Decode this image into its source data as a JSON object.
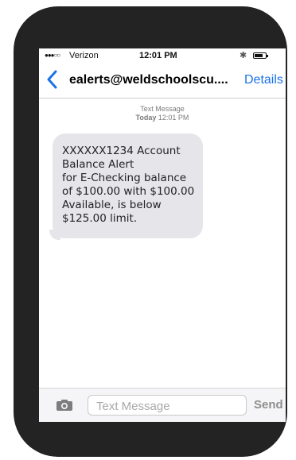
{
  "status_bar": {
    "signal": "●●●○○",
    "carrier": "Verizon",
    "time": "12:01 PM",
    "bluetooth": "✱"
  },
  "nav": {
    "back_icon": "chevron-left-icon",
    "contact": "ealerts@weldschoolscu....",
    "details_label": "Details",
    "accent": "#1a73e8"
  },
  "thread": {
    "meta_title": "Text Message",
    "meta_day": "Today",
    "meta_time": "12:01 PM"
  },
  "message": {
    "text": "XXXXXX1234 Account\nBalance Alert\nfor E-Checking balance\nof $100.00 with $100.00\nAvailable, is below\n$125.00 limit."
  },
  "composer": {
    "camera_icon": "camera-icon",
    "placeholder": "Text Message",
    "send_label": "Send"
  }
}
